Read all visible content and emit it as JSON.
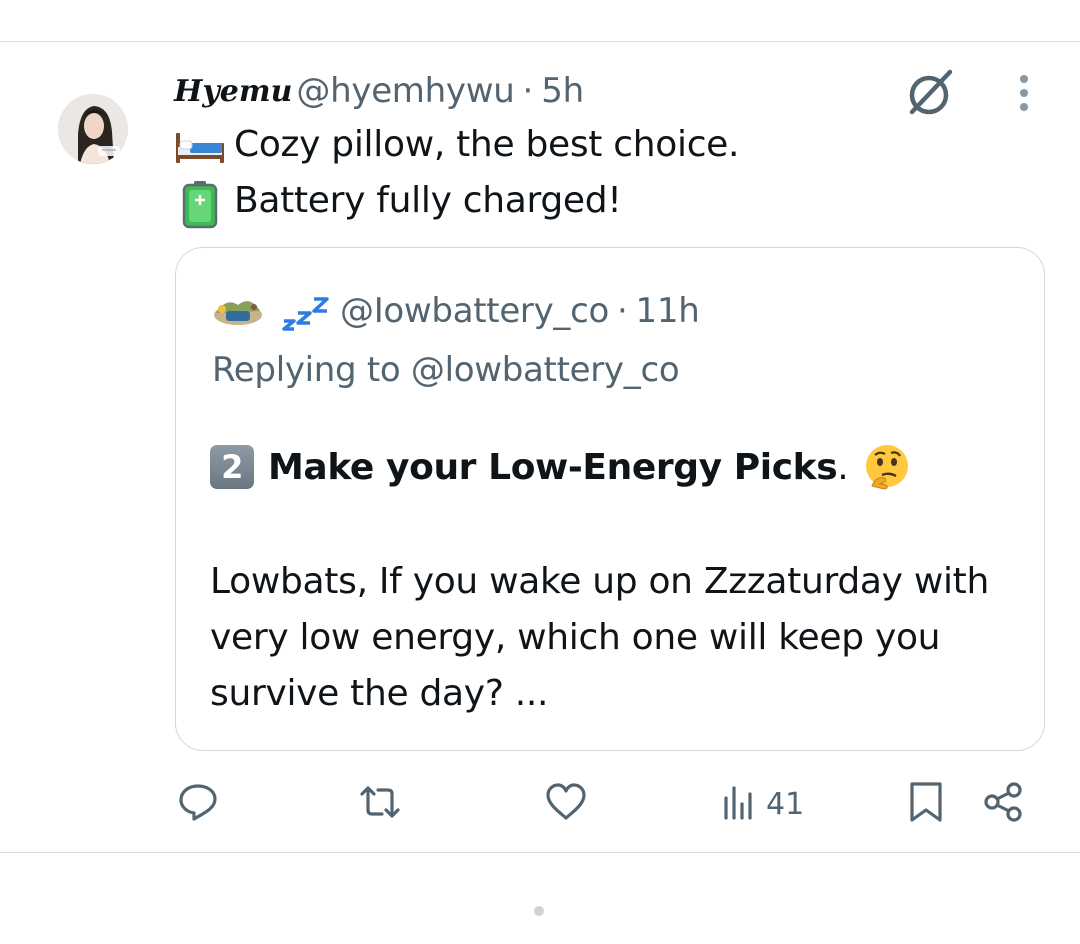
{
  "tweet": {
    "display_name": "Hyemu",
    "handle": "@hyemhywu",
    "separator": "·",
    "time": "5h",
    "lines": [
      {
        "emoji": "bed-emoji",
        "text": "Cozy pillow, the best choice."
      },
      {
        "emoji": "battery-emoji",
        "text": "Battery fully charged!"
      }
    ]
  },
  "quote": {
    "handle": "@Iowbattery_co",
    "separator": "·",
    "time": "11h",
    "replying_to": "Replying to @lowbattery_co",
    "keycap": "2",
    "title_bold": "Make your Low-Energy Picks",
    "title_suffix": ".",
    "body": "Lowbats, If you wake up on Zzzaturday with very low energy, which one will keep you survive the day? ..."
  },
  "actions": {
    "views_count": "41"
  },
  "icons": {
    "reply": "reply-icon",
    "retweet": "retweet-icon",
    "like": "heart-icon",
    "views": "views-icon",
    "bookmark": "bookmark-icon",
    "share": "share-icon",
    "grok": "grok-icon",
    "more": "more-icon"
  },
  "colors": {
    "text": "#0f1419",
    "secondary": "#536471",
    "border": "#cfd9de"
  }
}
